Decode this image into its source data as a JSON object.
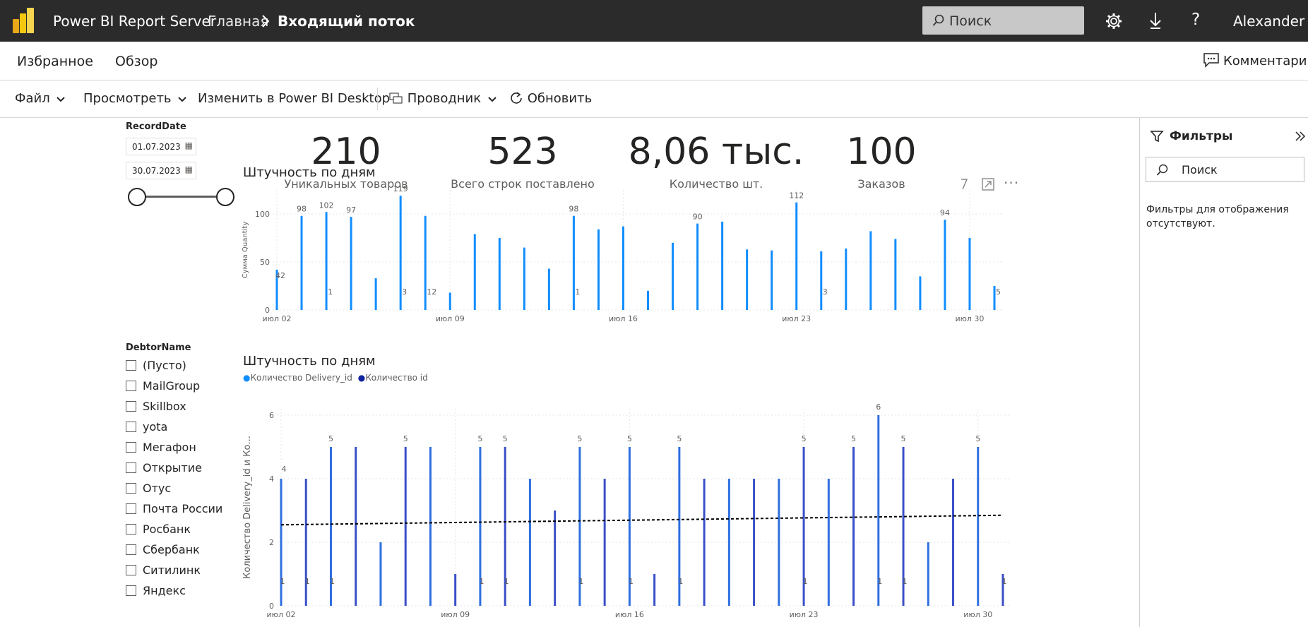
{
  "app": {
    "product": "Power BI Report Server",
    "breadcrumb_home": "Главная",
    "breadcrumb_current": "Входящий поток",
    "search_placeholder": "Поиск",
    "user": "Alexander"
  },
  "nav": {
    "favorites": "Избранное",
    "browse": "Обзор",
    "comments": "Комментарии"
  },
  "toolbar": {
    "file": "Файл",
    "view": "Просмотреть",
    "edit": "Изменить в Power BI Desktop",
    "explorer": "Проводник",
    "refresh": "Обновить"
  },
  "slicer_date": {
    "title": "RecordDate",
    "from": "01.07.2023",
    "to": "30.07.2023"
  },
  "kpis": [
    {
      "value": "210",
      "label": "Уникальных товаров"
    },
    {
      "value": "523",
      "label": "Всего строк поставлено"
    },
    {
      "value": "8,06 тыс.",
      "label": "Количество шт."
    },
    {
      "value": "100",
      "label": "Заказов"
    }
  ],
  "slicer_debtor": {
    "title": "DebtorName",
    "items": [
      "(Пусто)",
      "MailGroup",
      "Skillbox",
      "yota",
      "Мегафон",
      "Открытие",
      "Отус",
      "Почта России",
      "Росбанк",
      "Сбербанк",
      "Ситилинк",
      "Яндекс"
    ]
  },
  "filters": {
    "title": "Фильтры",
    "search_placeholder": "Поиск",
    "empty_text": "Фильтры для отображения отсутствуют."
  },
  "icons": {
    "logo": "power-bi-logo",
    "settings": "gear-icon",
    "download": "download-icon",
    "help": "help-icon"
  },
  "colors": {
    "topbar": "#2b2b2b",
    "series_light": "#118dff",
    "series_dark": "#12239e",
    "logo_yellow": "#f2c811"
  },
  "chart_data": [
    {
      "type": "bar",
      "title": "Штучность по дням",
      "ylabel": "Сумма Quantity",
      "ylim": [
        0,
        125
      ],
      "y_ticks": [
        0,
        50,
        100
      ],
      "x_ticks": [
        "июл 02",
        "июл 09",
        "июл 16",
        "июл 23",
        "июл 30"
      ],
      "x": [
        "2023-07-02",
        "2023-07-03",
        "2023-07-04",
        "2023-07-05",
        "2023-07-06",
        "2023-07-07",
        "2023-07-08",
        "2023-07-09",
        "2023-07-10",
        "2023-07-11",
        "2023-07-12",
        "2023-07-13",
        "2023-07-14",
        "2023-07-15",
        "2023-07-16",
        "2023-07-17",
        "2023-07-18",
        "2023-07-19",
        "2023-07-20",
        "2023-07-21",
        "2023-07-22",
        "2023-07-23",
        "2023-07-24",
        "2023-07-25",
        "2023-07-26",
        "2023-07-27",
        "2023-07-28",
        "2023-07-29",
        "2023-07-30",
        "2023-07-31"
      ],
      "values": [
        42,
        98,
        102,
        97,
        33,
        119,
        98,
        18,
        79,
        75,
        65,
        43,
        98,
        84,
        87,
        20,
        70,
        90,
        92,
        63,
        62,
        112,
        61,
        64,
        82,
        74,
        35,
        94,
        75,
        25
      ],
      "second_values": [
        null,
        null,
        1,
        null,
        null,
        3,
        12,
        null,
        null,
        null,
        null,
        null,
        1,
        null,
        null,
        null,
        null,
        null,
        null,
        null,
        null,
        null,
        3,
        null,
        null,
        null,
        null,
        null,
        null,
        5
      ],
      "labels_shown": {
        "0": "42",
        "1": "98",
        "2": "102",
        "3": "97",
        "5": "119",
        "12": "98",
        "17": "90",
        "21": "112",
        "27": "94"
      }
    },
    {
      "type": "bar",
      "title": "Штучность по дням",
      "ylabel": "Количество Delivery_id и Ко...",
      "ylim": [
        0,
        6.2
      ],
      "y_ticks": [
        0,
        2,
        4,
        6
      ],
      "x_ticks": [
        "июл 02",
        "июл 09",
        "июл 16",
        "июл 23",
        "июл 30"
      ],
      "legend": [
        "Количество Delivery_id",
        "Количество id"
      ],
      "series": [
        {
          "name": "Количество Delivery_id",
          "values": [
            4,
            4,
            5,
            5,
            2,
            5,
            5,
            1,
            5,
            5,
            4,
            3,
            5,
            4,
            5,
            1,
            5,
            4,
            4,
            4,
            4,
            5,
            4,
            5,
            6,
            5,
            2,
            4,
            5,
            1
          ]
        },
        {
          "name": "Количество id",
          "values": [
            1,
            1,
            1,
            null,
            null,
            null,
            null,
            null,
            1,
            1,
            null,
            null,
            1,
            null,
            1,
            null,
            1,
            null,
            null,
            null,
            null,
            1,
            null,
            null,
            1,
            1,
            null,
            null,
            null,
            1
          ]
        }
      ],
      "labels_shown": {
        "0": "4",
        "2": "5",
        "5": "5",
        "8": "5",
        "9": "5",
        "12": "5",
        "14": "5",
        "16": "5",
        "21": "5",
        "23": "5",
        "24": "6",
        "25": "5",
        "28": "5"
      },
      "trendline": true
    }
  ]
}
